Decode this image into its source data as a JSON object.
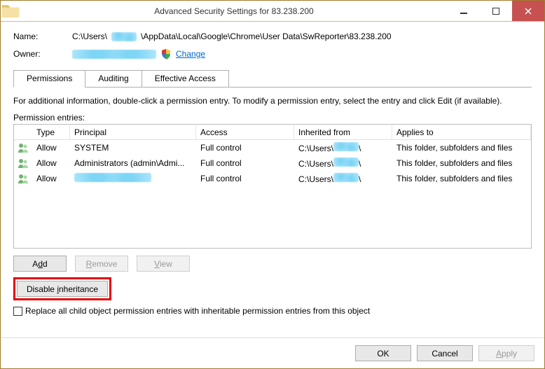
{
  "window": {
    "title": "Advanced Security Settings for 83.238.200"
  },
  "info": {
    "name_label": "Name:",
    "name_prefix": "C:\\Users\\",
    "name_suffix": "\\AppData\\Local\\Google\\Chrome\\User Data\\SwReporter\\83.238.200",
    "owner_label": "Owner:",
    "change_link": "Change"
  },
  "tabs": [
    {
      "label": "Permissions",
      "active": true
    },
    {
      "label": "Auditing",
      "active": false
    },
    {
      "label": "Effective Access",
      "active": false
    }
  ],
  "infotext": "For additional information, double-click a permission entry. To modify a permission entry, select the entry and click Edit (if available).",
  "entries_label": "Permission entries:",
  "columns": {
    "type": "Type",
    "principal": "Principal",
    "access": "Access",
    "inherited": "Inherited from",
    "applies": "Applies to"
  },
  "rows": [
    {
      "type": "Allow",
      "principal": "SYSTEM",
      "principal_redacted": false,
      "access": "Full control",
      "inherited_prefix": "C:\\Users\\",
      "applies": "This folder, subfolders and files"
    },
    {
      "type": "Allow",
      "principal": "Administrators (admin\\Admi...",
      "principal_redacted": false,
      "access": "Full control",
      "inherited_prefix": "C:\\Users\\",
      "applies": "This folder, subfolders and files"
    },
    {
      "type": "Allow",
      "principal": "",
      "principal_redacted": true,
      "access": "Full control",
      "inherited_prefix": "C:\\Users\\",
      "applies": "This folder, subfolders and files"
    }
  ],
  "buttons": {
    "add": "Add",
    "remove": "Remove",
    "view": "View",
    "disable_inheritance": "Disable inheritance",
    "ok": "OK",
    "cancel": "Cancel",
    "apply": "Apply"
  },
  "checkbox_label": "Replace all child object permission entries with inheritable permission entries from this object"
}
